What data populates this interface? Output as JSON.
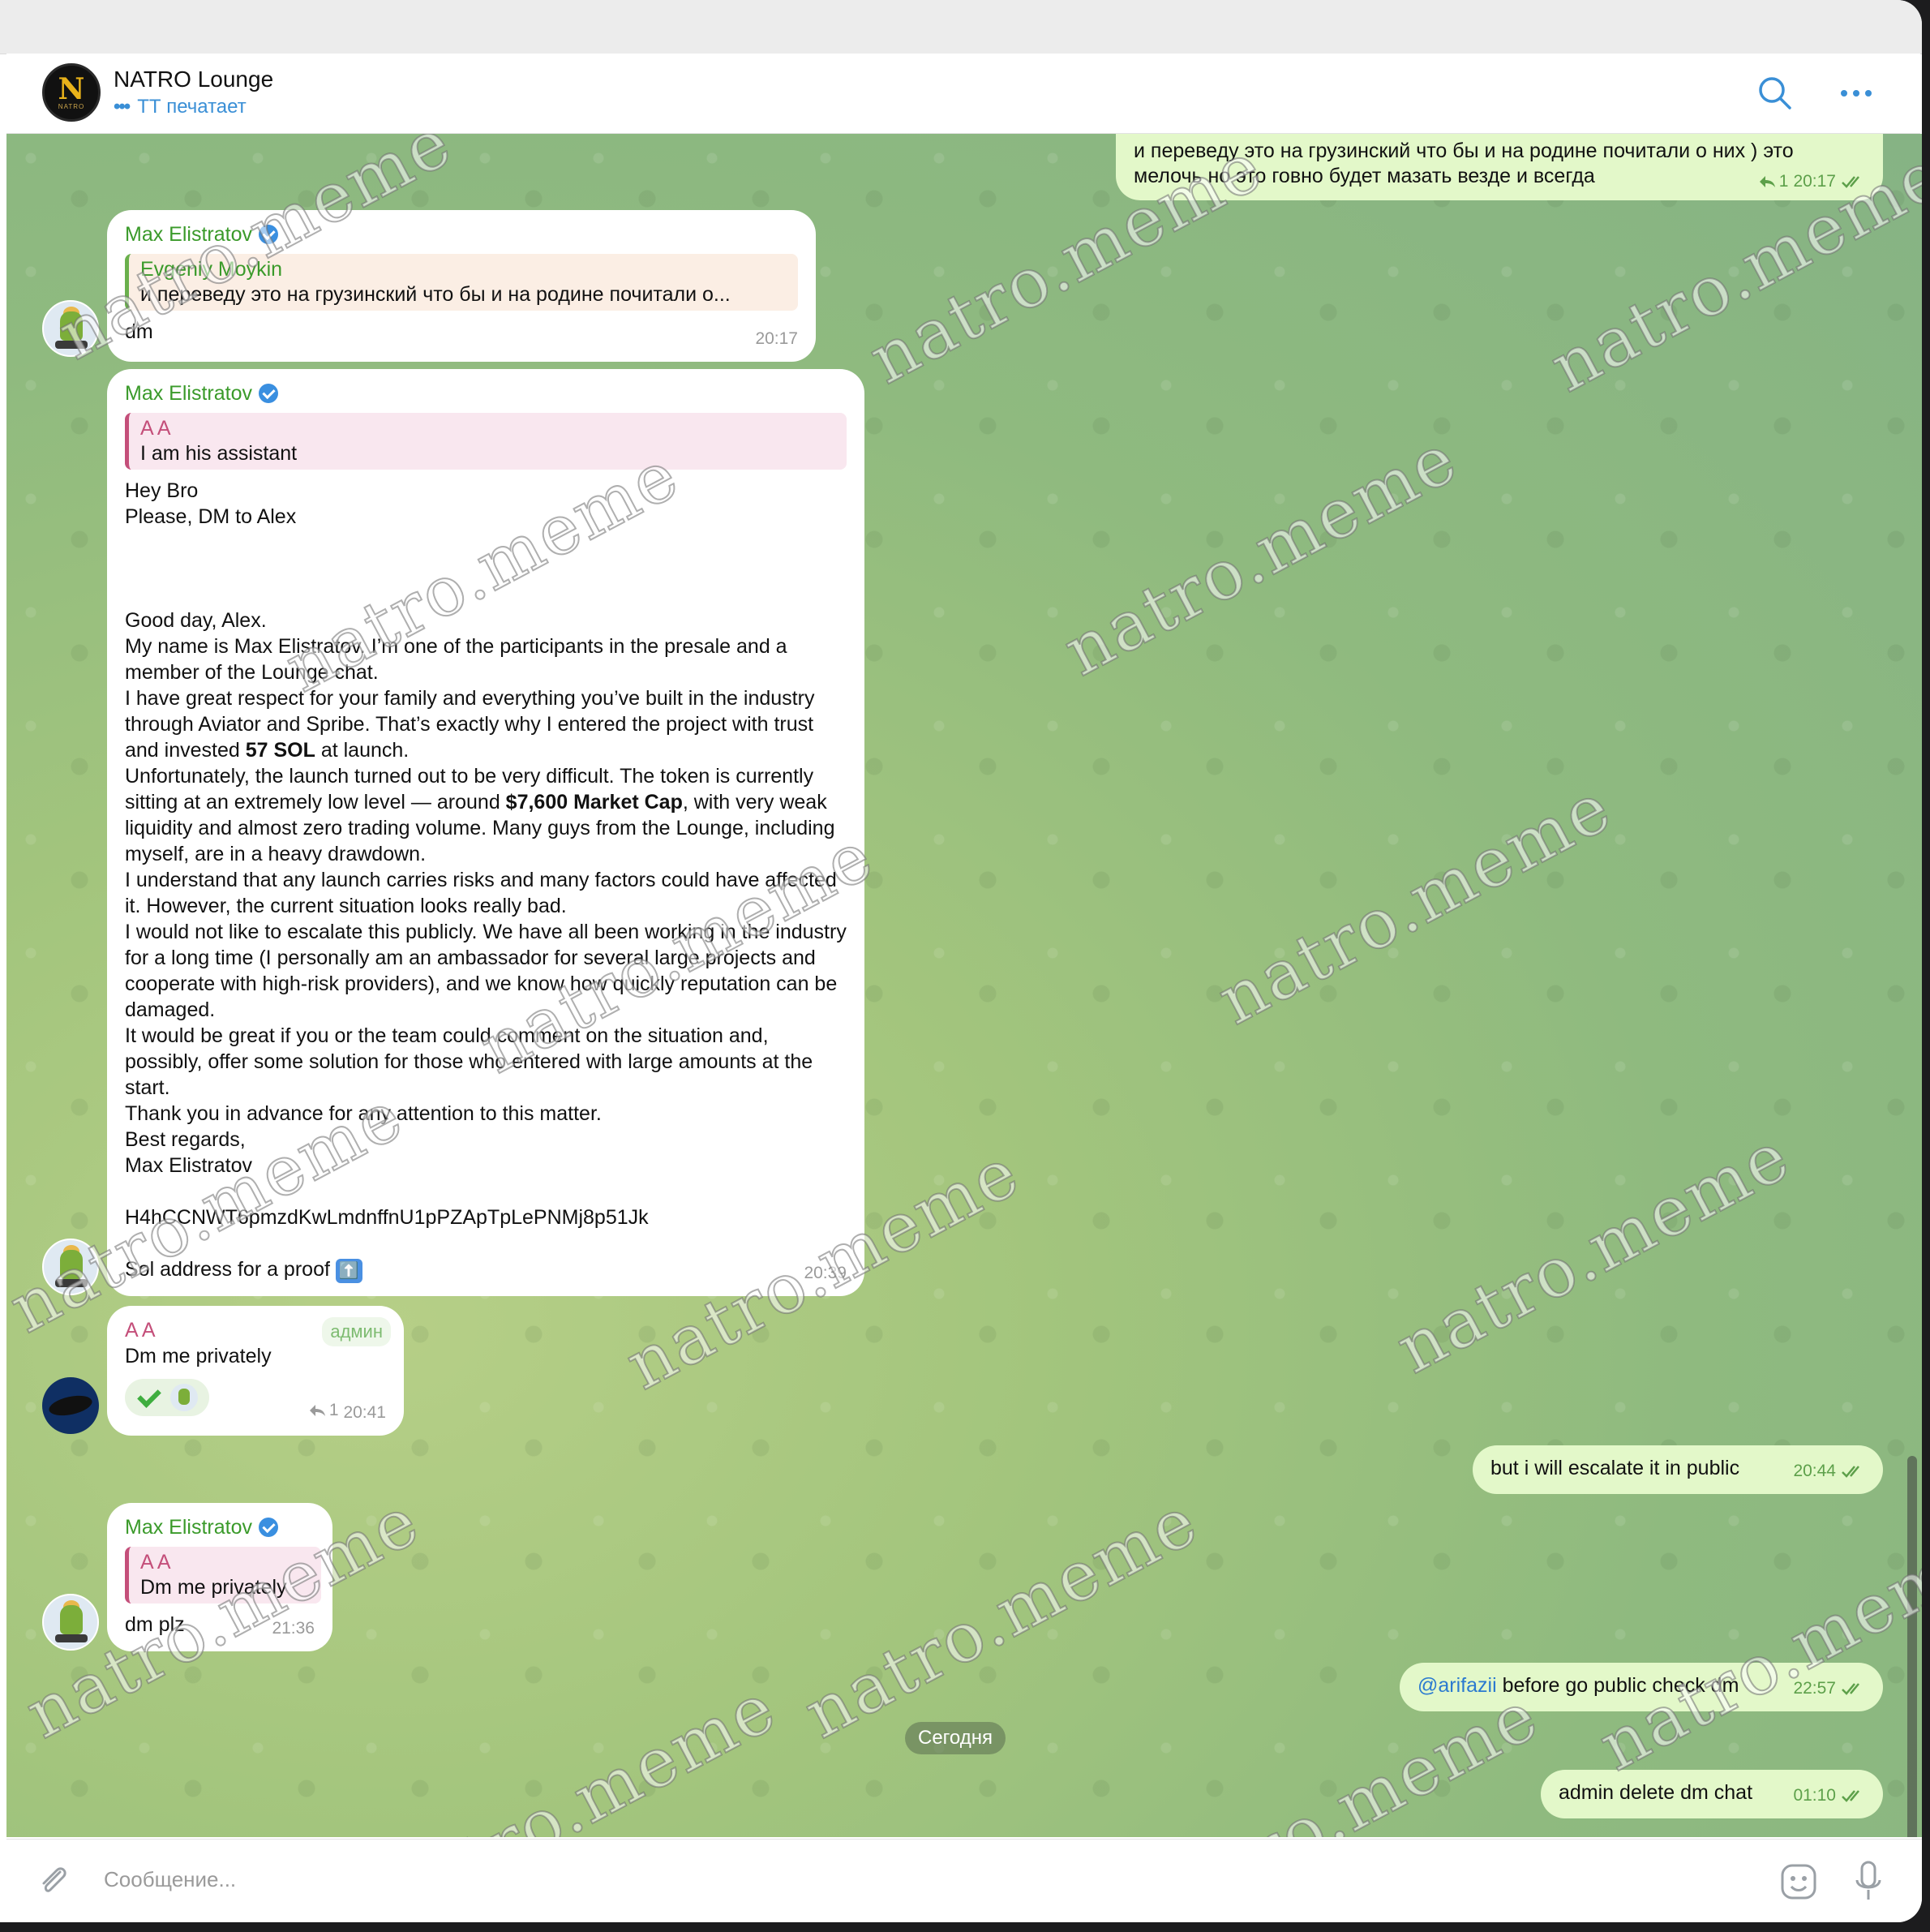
{
  "header": {
    "avatar_letter": "N",
    "avatar_small": "NATRO",
    "title": "NATRO Lounge",
    "status": "ТТ печатает"
  },
  "messages": {
    "m0": {
      "text": "и переведу это на грузинский что бы и на родине почитали о них ) это мелочь но это говно будет мазать везде и всегда",
      "replies": "1",
      "time": "20:17"
    },
    "m1": {
      "sender": "Max Elistratov",
      "reply_name": "Evgeniy Moykin",
      "reply_text": "и переведу это на грузинский что бы и на родине почитали о...",
      "text": "dm",
      "time": "20:17"
    },
    "m2": {
      "sender": "Max Elistratov",
      "reply_name": "A A",
      "reply_text": "I am his assistant",
      "line1": "Hey Bro",
      "line2": "Please, DM to Alex",
      "p1": "Good day, Alex.",
      "p2": "My name is Max Elistratov. I’m one of the participants in the presale and a member of the Lounge chat.",
      "p3a": "I have great respect for your family and everything you’ve built in the industry through Aviator and Spribe. That’s exactly why I entered the project with trust and invested ",
      "p3b": "57 SOL",
      "p3c": " at launch.",
      "p4a": "Unfortunately, the launch turned out to be very difficult. The token is currently sitting at an extremely low level — around ",
      "p4b": "$7,600 Market Cap",
      "p4c": ", with very weak liquidity and almost zero trading volume. Many guys from the Lounge, including myself, are in a heavy drawdown.",
      "p5": "I understand that any launch carries risks and many factors could have affected it. However, the current situation looks really bad.",
      "p6": "I would not like to escalate this publicly. We have all been working in the industry for a long time (I personally am an ambassador for several large projects and cooperate with high-risk providers), and we know how quickly reputation can be damaged.",
      "p7": "It would be great if you or the team could comment on the situation and, possibly, offer some solution for those who entered with large amounts at the start.",
      "p8": "Thank you in advance for any attention to this matter.",
      "p9": "Best regards,",
      "p10": "Max Elistratov",
      "address": "H4hCCNWT6pmzdKwLmdnffnU1pPZApTpLePNMj8p51Jk",
      "proof": "Sol address for a proof",
      "proof_emoji": "⬆️",
      "time": "20:39"
    },
    "m3": {
      "sender": "A A",
      "badge": "админ",
      "text": "Dm me privately",
      "replies": "1",
      "time": "20:41"
    },
    "m4": {
      "sender": "Max Elistratov",
      "reply_name": "A A",
      "reply_text": "Dm me privately",
      "text": "dm plz",
      "time": "21:36"
    },
    "m5": {
      "text": "but i will escalate it in public",
      "time": "20:44"
    },
    "m6": {
      "mention": "@arifazii",
      "text": " before go public check dm",
      "time": "22:57"
    },
    "date_divider": "Сегодня",
    "m7": {
      "text": "admin delete dm chat",
      "time": "01:10"
    }
  },
  "composer": {
    "placeholder": "Сообщение..."
  },
  "watermark": "natro.meme",
  "colors": {
    "accent": "#3a8fd6",
    "sender_green": "#3a9a2a",
    "sender_pink": "#c44f7a",
    "outgoing_bubble": "#e3f8c9"
  }
}
